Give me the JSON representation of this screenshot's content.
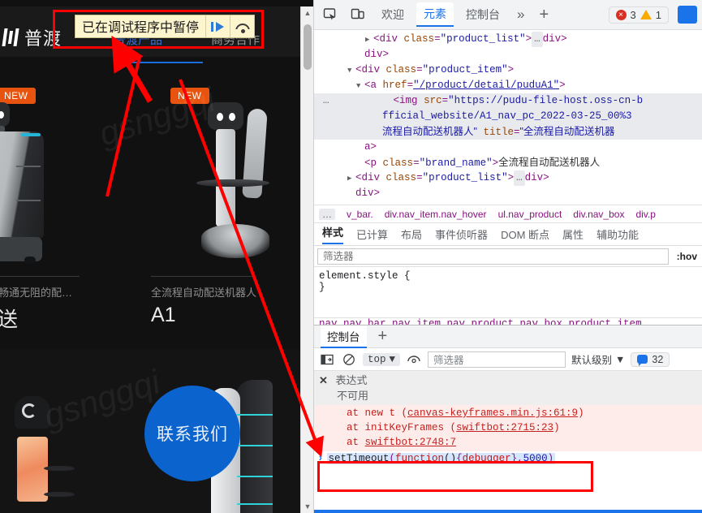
{
  "webpage": {
    "brand": "普渡",
    "nav": [
      {
        "label": "普渡产品",
        "active": true
      },
      {
        "label": "商务合作",
        "active": false
      }
    ],
    "products": [
      {
        "badge": "NEW",
        "subtitle": "峰期畅通无阻的配…",
        "title": "乐送"
      },
      {
        "badge": "NEW",
        "subtitle": "全流程自动配送机器人",
        "title": "A1"
      }
    ],
    "contact_button": "联系我们",
    "watermark": "gsnggqi"
  },
  "debugger_banner": {
    "text": "已在调试程序中暂停",
    "resume_icon": "resume-script-icon",
    "stepover_icon": "step-over-icon"
  },
  "devtools": {
    "titlebar": {
      "inspect_icon": "inspect-element-icon",
      "device_icon": "device-toolbar-icon",
      "tabs": [
        {
          "label": "欢迎",
          "active": false
        },
        {
          "label": "元素",
          "active": true
        },
        {
          "label": "控制台",
          "active": false
        }
      ],
      "more_tabs_icon": "chevron-double-right-icon",
      "add_tab_icon": "plus-icon",
      "errors_count": "3",
      "warnings_count": "1",
      "error_icon": "error-circle-icon",
      "warning_icon": "warning-triangle-icon",
      "settings_icon": "blue-square-icon"
    },
    "elements_tree": [
      {
        "indent": 5,
        "caret": "▶",
        "parts": [
          {
            "t": "punct",
            "v": "<"
          },
          {
            "t": "tag",
            "v": "div"
          },
          {
            "t": "sp",
            "v": " "
          },
          {
            "t": "attr",
            "v": "class"
          },
          {
            "t": "punct",
            "v": "="
          },
          {
            "t": "val",
            "v": "\"product_list\""
          },
          {
            "t": "punct",
            "v": ">"
          },
          {
            "t": "ell",
            "v": "…"
          },
          {
            "t": "punct",
            "v": "</"
          },
          {
            "t": "tag",
            "v": "div"
          },
          {
            "t": "punct",
            "v": ">"
          }
        ]
      },
      {
        "indent": 4,
        "caret": "",
        "parts": [
          {
            "t": "punct",
            "v": "</"
          },
          {
            "t": "tag",
            "v": "div"
          },
          {
            "t": "punct",
            "v": ">"
          }
        ]
      },
      {
        "indent": 3,
        "caret": "▼",
        "parts": [
          {
            "t": "punct",
            "v": "<"
          },
          {
            "t": "tag",
            "v": "div"
          },
          {
            "t": "sp",
            "v": " "
          },
          {
            "t": "attr",
            "v": "class"
          },
          {
            "t": "punct",
            "v": "="
          },
          {
            "t": "val",
            "v": "\"product_item\""
          },
          {
            "t": "punct",
            "v": ">"
          }
        ]
      },
      {
        "indent": 4,
        "caret": "▼",
        "parts": [
          {
            "t": "punct",
            "v": "<"
          },
          {
            "t": "tag",
            "v": "a"
          },
          {
            "t": "sp",
            "v": " "
          },
          {
            "t": "attr",
            "v": "href"
          },
          {
            "t": "punct",
            "v": "="
          },
          {
            "t": "link",
            "v": "\"/product/detail/puduA1\""
          },
          {
            "t": "punct",
            "v": ">"
          }
        ]
      },
      {
        "indent": 6,
        "caret": "",
        "selected": true,
        "ellipsis_gutter": "…",
        "parts": [
          {
            "t": "punct",
            "v": "<"
          },
          {
            "t": "tag",
            "v": "img"
          },
          {
            "t": "sp",
            "v": " "
          },
          {
            "t": "attr",
            "v": "src"
          },
          {
            "t": "punct",
            "v": "="
          },
          {
            "t": "val",
            "v": "\"https://pudu-file-host.oss-cn-b"
          }
        ]
      },
      {
        "indent": 6,
        "caret": "",
        "selected": true,
        "parts": [
          {
            "t": "val",
            "v": "fficial_website/A1_nav_pc_2022-03-25_00%3"
          }
        ]
      },
      {
        "indent": 6,
        "caret": "",
        "selected": true,
        "parts": [
          {
            "t": "zh",
            "v": "流程自动配送机器人\""
          },
          {
            "t": "sp",
            "v": " "
          },
          {
            "t": "attr",
            "v": "title"
          },
          {
            "t": "punct",
            "v": "="
          },
          {
            "t": "zh",
            "v": "\"全流程自动配送机器"
          }
        ]
      },
      {
        "indent": 4,
        "caret": "",
        "parts": [
          {
            "t": "punct",
            "v": "</"
          },
          {
            "t": "tag",
            "v": "a"
          },
          {
            "t": "punct",
            "v": ">"
          }
        ]
      },
      {
        "indent": 4,
        "caret": "",
        "parts": [
          {
            "t": "punct",
            "v": "<"
          },
          {
            "t": "tag",
            "v": "p"
          },
          {
            "t": "sp",
            "v": " "
          },
          {
            "t": "attr",
            "v": "class"
          },
          {
            "t": "punct",
            "v": "="
          },
          {
            "t": "val",
            "v": "\"brand_name\""
          },
          {
            "t": "punct",
            "v": ">"
          },
          {
            "t": "zhtxt",
            "v": "全流程自动配送机器人"
          },
          {
            "t": "punct",
            "v": "</p"
          }
        ]
      },
      {
        "indent": 3,
        "caret": "▶",
        "parts": [
          {
            "t": "punct",
            "v": "<"
          },
          {
            "t": "tag",
            "v": "div"
          },
          {
            "t": "sp",
            "v": " "
          },
          {
            "t": "attr",
            "v": "class"
          },
          {
            "t": "punct",
            "v": "="
          },
          {
            "t": "val",
            "v": "\"product_list\""
          },
          {
            "t": "punct",
            "v": ">"
          },
          {
            "t": "ell",
            "v": "…"
          },
          {
            "t": "punct",
            "v": "</"
          },
          {
            "t": "tag",
            "v": "div"
          },
          {
            "t": "punct",
            "v": ">"
          }
        ]
      },
      {
        "indent": 3,
        "caret": "",
        "parts": [
          {
            "t": "punct",
            "v": "</"
          },
          {
            "t": "tag",
            "v": "div"
          },
          {
            "t": "punct",
            "v": ">"
          }
        ]
      }
    ],
    "breadcrumb": {
      "overflow": "…",
      "items": [
        "v_bar.",
        "div.nav_item.nav_hover",
        "ul.nav_product",
        "div.nav_box",
        "div.p"
      ]
    },
    "styles_tabs": [
      {
        "label": "样式",
        "active": true
      },
      {
        "label": "已计算",
        "active": false
      },
      {
        "label": "布局",
        "active": false
      },
      {
        "label": "事件侦听器",
        "active": false
      },
      {
        "label": "DOM 断点",
        "active": false
      },
      {
        "label": "属性",
        "active": false
      },
      {
        "label": "辅助功能",
        "active": false
      }
    ],
    "styles_filter_placeholder": "筛选器",
    "hov_label": ":hov",
    "styles_rule": {
      "selector": "element.style {",
      "close": "}"
    },
    "inherited_cut": "nav  nav_bar  nav_item  nav_product  nav_box  product_item",
    "console": {
      "tab_label": "控制台",
      "add_icon": "plus-icon",
      "toolbar": {
        "sidebar_icon": "console-sidebar-icon",
        "clear_icon": "clear-console-icon",
        "context": "top",
        "eye_icon": "live-expression-icon",
        "filter_placeholder": "筛选器",
        "level": "默认级别",
        "issues_count": "32",
        "issues_icon": "issues-bubble-icon"
      },
      "expression": {
        "close_icon": "close-icon",
        "label": "表达式",
        "value": "不可用"
      },
      "stack_lines": [
        {
          "prefix": "at new t (",
          "link": "canvas-keyframes.min.js:61:9",
          "suffix": ")"
        },
        {
          "prefix": "at initKeyFrames (",
          "link": "swiftbot:2715:23",
          "suffix": ")"
        },
        {
          "prefix": "at ",
          "link": "swiftbot:2748:7",
          "suffix": ""
        }
      ],
      "prompt": {
        "chevron": "›",
        "tokens": [
          {
            "t": "id",
            "v": "setTimeout"
          },
          {
            "t": "punc",
            "v": "("
          },
          {
            "t": "kw",
            "v": "function"
          },
          {
            "t": "id",
            "v": "()"
          },
          {
            "t": "punc",
            "v": "{"
          },
          {
            "t": "kw",
            "v": "debugger"
          },
          {
            "t": "punc",
            "v": "}"
          },
          {
            "t": "punc",
            "v": ","
          },
          {
            "t": "num",
            "v": "5000"
          },
          {
            "t": "punc",
            "v": ")"
          }
        ]
      }
    }
  },
  "annotations": {
    "highlight_color": "#ff0000",
    "boxes": [
      "debugger-banner-highlight",
      "console-prompt-highlight"
    ],
    "arrows": [
      "arrow-to-banner",
      "arrow-to-console-prompt"
    ]
  }
}
